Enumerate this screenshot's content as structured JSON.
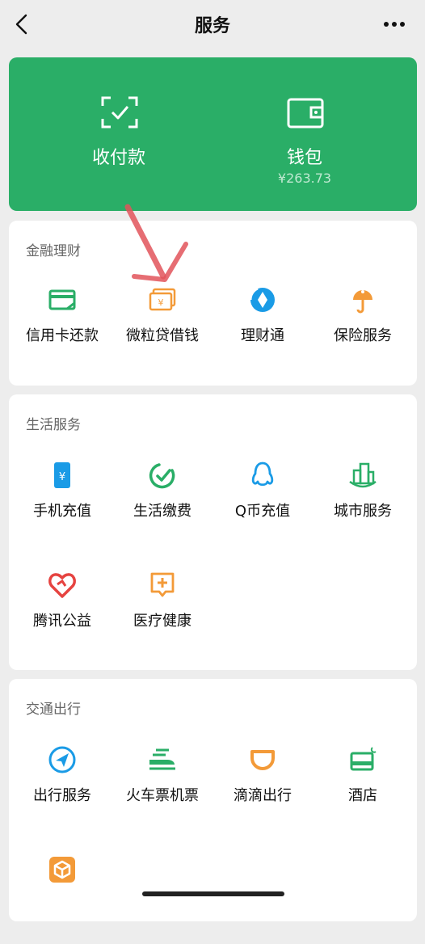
{
  "header": {
    "title": "服务"
  },
  "wallet_card": {
    "items": [
      {
        "label": "收付款",
        "icon": "scan-qr-icon"
      },
      {
        "label": "钱包",
        "icon": "wallet-icon",
        "balance": "¥263.73"
      }
    ]
  },
  "sections": [
    {
      "title": "金融理财",
      "items": [
        {
          "label": "信用卡还款",
          "icon": "credit-card-icon",
          "color": "#2aae67"
        },
        {
          "label": "微粒贷借钱",
          "icon": "yuan-cards-icon",
          "color": "#f39a38"
        },
        {
          "label": "理财通",
          "icon": "licaitong-icon",
          "color": "#1a9be6"
        },
        {
          "label": "保险服务",
          "icon": "insurance-umbrella-icon",
          "color": "#f39a38"
        }
      ]
    },
    {
      "title": "生活服务",
      "items": [
        {
          "label": "手机充值",
          "icon": "phone-yuan-icon",
          "color": "#1a9be6"
        },
        {
          "label": "生活缴费",
          "icon": "check-circle-icon",
          "color": "#2aae67"
        },
        {
          "label": "Q币充值",
          "icon": "penguin-icon",
          "color": "#1a9be6"
        },
        {
          "label": "城市服务",
          "icon": "city-buildings-icon",
          "color": "#2aae67"
        },
        {
          "label": "腾讯公益",
          "icon": "charity-heart-icon",
          "color": "#e64340"
        },
        {
          "label": "医疗健康",
          "icon": "medical-cross-icon",
          "color": "#f39a38"
        }
      ]
    },
    {
      "title": "交通出行",
      "items": [
        {
          "label": "出行服务",
          "icon": "navigation-arrow-icon",
          "color": "#1a9be6"
        },
        {
          "label": "火车票机票",
          "icon": "train-icon",
          "color": "#2aae67"
        },
        {
          "label": "滴滴出行",
          "icon": "didi-icon",
          "color": "#f39a38"
        },
        {
          "label": "酒店",
          "icon": "hotel-bed-icon",
          "color": "#2aae67"
        },
        {
          "label": "",
          "icon": "box-icon",
          "color": "#f39a38"
        }
      ]
    }
  ]
}
